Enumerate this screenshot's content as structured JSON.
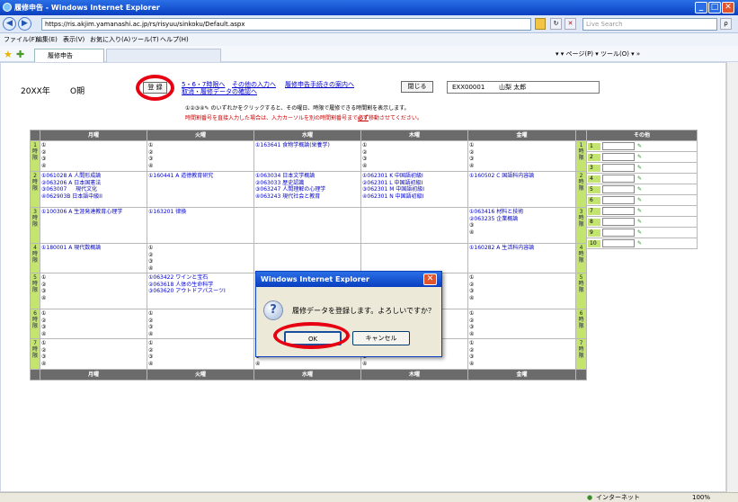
{
  "window": {
    "title": "履修申告 - Windows Internet Explorer",
    "min": "_",
    "max": "□",
    "close": "✕"
  },
  "address": {
    "url": "https://ris.akjim.yamanashi.ac.jp/rs/risyuu/sinkoku/Default.aspx",
    "search_placeholder": "Live Search",
    "back": "◀",
    "forward": "▶",
    "refresh": "↻",
    "stop": "✕",
    "search_icon": "ρ"
  },
  "menu": [
    "ファイル(F)",
    "編集(E)",
    "表示(V)",
    "お気に入り(A)",
    "ツール(T)",
    "ヘルプ(H)"
  ],
  "favorites": {
    "tab_label": "履修申告",
    "tools": "▾  ▾ ページ(P) ▾  ツール(O) ▾ »"
  },
  "header": {
    "year": "20XX年",
    "term": "O期",
    "register_button": "登 録",
    "link_567": "5・6・7時限へ",
    "link_other": "その他の入力へ",
    "link_guide": "履修申告手続きの案内へ",
    "link_confirm": "取消・履修データの確認へ",
    "close_button": "閉じる",
    "student_id": "EXX00001",
    "student_name": "山梨 太郎",
    "notice1": "①②③④✎ のいずれかをクリックすると、その曜日、時限で履修できる時間割を表示します。",
    "notice2_a": "時間割番号を直接入力した場合は、入力カーソルを別の時間割番号まで",
    "notice2_b": "必ず",
    "notice2_c": "移動させてください。"
  },
  "days": [
    "月曜",
    "火曜",
    "水曜",
    "木曜",
    "金曜"
  ],
  "other_header": "その他",
  "periods": [
    {
      "label": "1 時限",
      "cells": [
        [
          "①",
          "②",
          "③",
          "④"
        ],
        [
          "①",
          "②",
          "③",
          "④"
        ],
        [
          "①163641 食物学概論(栄養学)"
        ],
        [
          "①",
          "②",
          "③",
          "④"
        ],
        [
          "①",
          "②",
          "③",
          "④"
        ]
      ]
    },
    {
      "label": "2 時限",
      "cells": [
        [
          "①061028 A 人間形成論",
          "②063206 A 日本国憲法",
          "③063007 　 現代文化",
          "④062903B 日本語中級II"
        ],
        [
          "①160441 A 道徳教育研究"
        ],
        [
          "①063034 日本文学概論",
          "②063033 歴史認識",
          "③063247 人間理解の心理学",
          "④063243 現代社会と教育"
        ],
        [
          "①062301 K 中国語初級I",
          "②062301 L 中国語初級I",
          "③062301 M 中国語初級I",
          "④062301 N 中国語初級I"
        ],
        [
          "①160502 C 国語科内容論"
        ]
      ]
    },
    {
      "label": "3 時限",
      "cells": [
        [
          "①100306 A 生涯発達教育心理学"
        ],
        [
          "①163201 律換"
        ],
        [
          ""
        ],
        [
          ""
        ],
        [
          "①063416 材料と技術",
          "②063235 企業概論",
          "③",
          "④"
        ]
      ]
    },
    {
      "label": "4 時限",
      "cells": [
        [
          "①180001 A 現代数概論"
        ],
        [
          "①",
          "②",
          "③",
          "④"
        ],
        [
          ""
        ],
        [
          ""
        ],
        [
          "①160282 A 生活科内容論"
        ]
      ]
    },
    {
      "label": "5 時限",
      "cells": [
        [
          "①",
          "②",
          "③",
          "④"
        ],
        [
          "①063422 ワインと宝石",
          "②063618 人体の生命科学",
          "③063620 アウトドアパスーツI"
        ],
        [
          "①"
        ],
        [
          ""
        ],
        [
          "①",
          "②",
          "③",
          "④"
        ]
      ]
    },
    {
      "label": "6 時限",
      "cells": [
        [
          "①",
          "②",
          "③",
          "④"
        ],
        [
          "①",
          "②",
          "③",
          "④"
        ],
        [
          "①",
          "②",
          "③",
          "④"
        ],
        [
          "①",
          "②",
          "③",
          "④"
        ],
        [
          "①",
          "②",
          "③",
          "④"
        ]
      ]
    },
    {
      "label": "7 時限",
      "cells": [
        [
          "①",
          "②",
          "③",
          "④"
        ],
        [
          "①",
          "②",
          "③",
          "④"
        ],
        [
          "①",
          "②",
          "③",
          "④"
        ],
        [
          "①",
          "②",
          "③",
          "④"
        ],
        [
          "①",
          "②",
          "③",
          "④"
        ]
      ]
    }
  ],
  "other_rows": [
    "1",
    "2",
    "3",
    "4",
    "5",
    "6",
    "7",
    "8",
    "9",
    "10"
  ],
  "dialog": {
    "title": "Windows Internet Explorer",
    "message": "履修データを登録します。よろしいですか？",
    "ok": "OK",
    "cancel": "キャンセル",
    "icon": "?"
  },
  "status": {
    "zone": "インターネット",
    "zoom": "100%"
  },
  "colors": {
    "accent_red": "#e60012",
    "period_green": "#c3e46f",
    "header_gray": "#6b6b6b"
  }
}
